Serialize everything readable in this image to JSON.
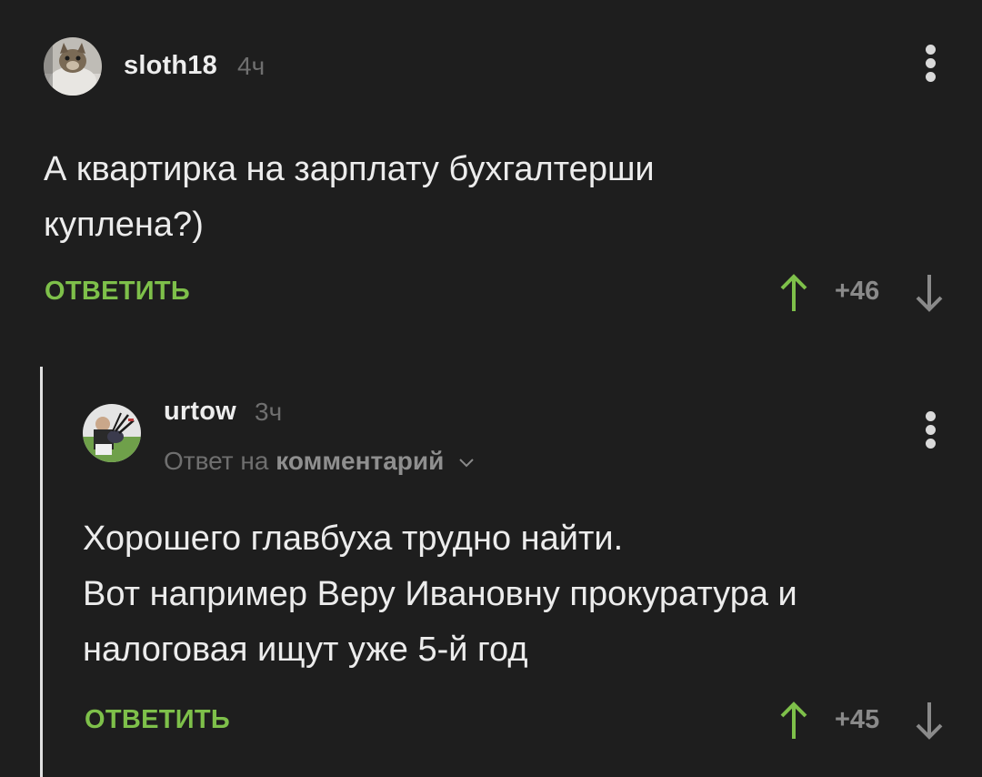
{
  "comments": [
    {
      "username": "sloth18",
      "time": "4ч",
      "avatar_icon": "cat-avatar",
      "body_lines": [
        "А квартирка на зарплату бухгалтерши",
        "куплена?)"
      ],
      "reply_label": "ОТВЕТИТЬ",
      "votes": "+46"
    },
    {
      "username": "urtow",
      "time": "3ч",
      "avatar_icon": "bagpiper-avatar",
      "reply_to_prefix": "Ответ на",
      "reply_to_target": "комментарий",
      "body_lines": [
        "Хорошего главбуха трудно найти.",
        "Вот например Веру Ивановну прокуратура и",
        "налоговая ищут уже 5-й год"
      ],
      "reply_label": "ОТВЕТИТЬ",
      "votes": "+45"
    }
  ],
  "colors": {
    "background": "#1e1e1e",
    "accent_green": "#7ec04a",
    "muted": "#6f6f6f",
    "text": "#ececec"
  }
}
